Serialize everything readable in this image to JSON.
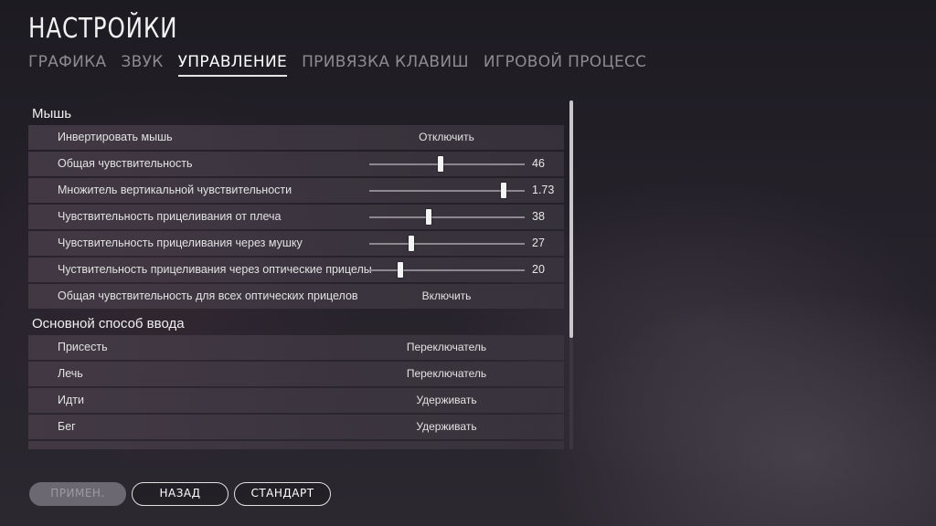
{
  "title": "НАСТРОЙКИ",
  "tabs": [
    {
      "label": "ГРАФИКА"
    },
    {
      "label": "ЗВУК"
    },
    {
      "label": "УПРАВЛЕНИЕ"
    },
    {
      "label": "ПРИВЯЗКА КЛАВИШ"
    },
    {
      "label": "ИГРОВОЙ ПРОЦЕСС"
    }
  ],
  "active_tab": "УПРАВЛЕНИЕ",
  "mouse": {
    "header": "Мышь",
    "invert": {
      "label": "Инвертировать мышь",
      "value": "Отключить"
    },
    "general_sensitivity": {
      "label": "Общая чувствительность",
      "value": "46",
      "fraction": 0.46
    },
    "vertical_multiplier": {
      "label": "Множитель вертикальной чувствительности",
      "value": "1.73",
      "fraction": 0.865
    },
    "shoulder_sensitivity": {
      "label": "Чувствительность прицеливания от плеча",
      "value": "38",
      "fraction": 0.38
    },
    "ads_sensitivity": {
      "label": "Чувствительность прицеливания через мушку",
      "value": "27",
      "fraction": 0.27
    },
    "scope_sensitivity": {
      "label": "Чуствительность прицеливания через оптические прицелы",
      "value": "20",
      "fraction": 0.2
    },
    "all_scopes_sensitivity": {
      "label": "Общая чувствительность для всех оптических прицелов",
      "value": "Включить"
    }
  },
  "input": {
    "header": "Основной способ ввода",
    "crouch": {
      "label": "Присесть",
      "value": "Переключатель"
    },
    "prone": {
      "label": "Лечь",
      "value": "Переключатель"
    },
    "walk": {
      "label": "Идти",
      "value": "Удерживать"
    },
    "sprint": {
      "label": "Бег",
      "value": "Удерживать"
    }
  },
  "buttons": {
    "apply": "ПРИМЕН.",
    "back": "НАЗАД",
    "default": "СТАНДАРТ"
  }
}
